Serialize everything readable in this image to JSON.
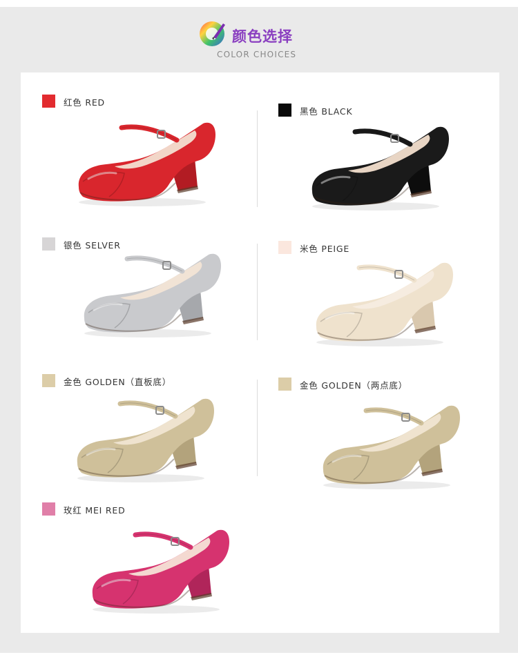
{
  "header": {
    "title_cn": "颜色选择",
    "title_en": "COLOR CHOICES"
  },
  "colors": [
    {
      "label": "红色 RED",
      "swatch": "#e22b2f",
      "shoe": "#d9262d",
      "heel": "#b21c23",
      "lining": "#f2d6c8"
    },
    {
      "label": "黑色 BLACK",
      "swatch": "#0a0a0a",
      "shoe": "#1a1a1a",
      "heel": "#0d0d0d",
      "lining": "#e8d5c4"
    },
    {
      "label": "银色 SELVER",
      "swatch": "#d7d5d6",
      "shoe": "#c9cacd",
      "heel": "#a6a8ac",
      "lining": "#f1e3d5"
    },
    {
      "label": "米色 PEIGE",
      "swatch": "#fbe7de",
      "shoe": "#efe2cd",
      "heel": "#d9c8ae",
      "lining": "#f6ece0"
    },
    {
      "label": "金色 GOLDEN（直板底）",
      "swatch": "#dccda8",
      "shoe": "#cfc09a",
      "heel": "#b3a37c",
      "lining": "#efe3cf"
    },
    {
      "label": "金色 GOLDEN（两点底）",
      "swatch": "#dccda8",
      "shoe": "#cfc09a",
      "heel": "#b3a37c",
      "lining": "#efe3cf"
    },
    {
      "label": "玫红 MEI RED",
      "swatch": "#e07fa8",
      "shoe": "#d6336f",
      "heel": "#b0255a",
      "lining": "#f4d9d1"
    }
  ]
}
